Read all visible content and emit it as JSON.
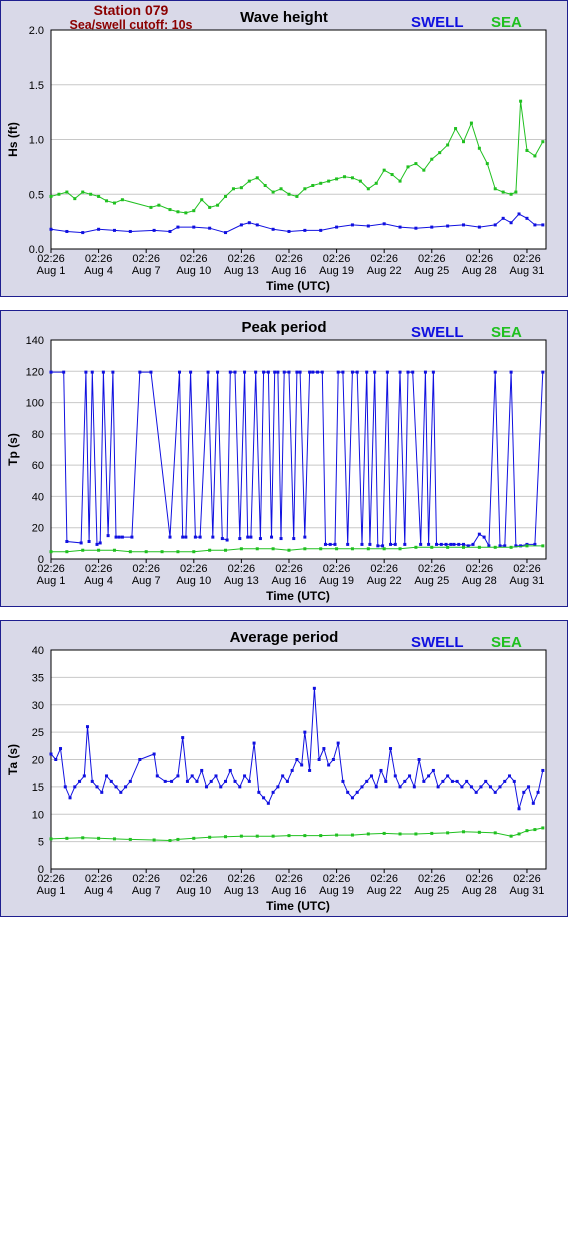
{
  "header": {
    "station": "Station 079",
    "cutoff": "Sea/swell cutoff: 10s"
  },
  "legend": {
    "swell": "SWELL",
    "sea": "SEA"
  },
  "colors": {
    "swell": "#1010e0",
    "sea": "#20c020",
    "frame": "#1f1f8f",
    "panel_bg": "#d9d9e8",
    "header": "#8b0000"
  },
  "chart_data": [
    {
      "type": "scatter",
      "title": "Wave height",
      "xlabel": "Time (UTC)",
      "ylabel": "Hs (ft)",
      "ylim": [
        0,
        2
      ],
      "yticks": [
        "0.0",
        "0.5",
        "1.0",
        "1.5",
        "2.0"
      ],
      "xlim": [
        0,
        31.2
      ],
      "xticks": [
        {
          "time": "02:26",
          "date": "Aug 1",
          "day": 0
        },
        {
          "time": "02:26",
          "date": "Aug 4",
          "day": 3
        },
        {
          "time": "02:26",
          "date": "Aug 7",
          "day": 6
        },
        {
          "time": "02:26",
          "date": "Aug 10",
          "day": 9
        },
        {
          "time": "02:26",
          "date": "Aug 13",
          "day": 12
        },
        {
          "time": "02:26",
          "date": "Aug 16",
          "day": 15
        },
        {
          "time": "02:26",
          "date": "Aug 19",
          "day": 18
        },
        {
          "time": "02:26",
          "date": "Aug 22",
          "day": 21
        },
        {
          "time": "02:26",
          "date": "Aug 25",
          "day": 24
        },
        {
          "time": "02:26",
          "date": "Aug 28",
          "day": 27
        },
        {
          "time": "02:26",
          "date": "Aug 31",
          "day": 30
        }
      ],
      "grid": true,
      "series": [
        {
          "name": "SWELL",
          "color": "#1010e0",
          "x": [
            0,
            1,
            2,
            3,
            4,
            5,
            6.5,
            7.5,
            8,
            9,
            10,
            11,
            12,
            12.5,
            13,
            14,
            15,
            16,
            17,
            18,
            19,
            20,
            21,
            22,
            23,
            24,
            25,
            26,
            27,
            28,
            28.5,
            29,
            29.5,
            30,
            30.5,
            31
          ],
          "y": [
            0.18,
            0.16,
            0.15,
            0.18,
            0.17,
            0.16,
            0.17,
            0.16,
            0.2,
            0.2,
            0.19,
            0.15,
            0.22,
            0.24,
            0.22,
            0.18,
            0.16,
            0.17,
            0.17,
            0.2,
            0.22,
            0.21,
            0.23,
            0.2,
            0.19,
            0.2,
            0.21,
            0.22,
            0.2,
            0.22,
            0.28,
            0.24,
            0.32,
            0.28,
            0.22,
            0.22
          ]
        },
        {
          "name": "SEA",
          "color": "#20c020",
          "x": [
            0,
            0.5,
            1,
            1.5,
            2,
            2.5,
            3,
            3.5,
            4,
            4.5,
            6.3,
            6.8,
            7.5,
            8,
            8.5,
            9,
            9.5,
            10,
            10.5,
            11,
            11.5,
            12,
            12.5,
            13,
            13.5,
            14,
            14.5,
            15,
            15.5,
            16,
            16.5,
            17,
            17.5,
            18,
            18.5,
            19,
            19.5,
            20,
            20.5,
            21,
            21.5,
            22,
            22.5,
            23,
            23.5,
            24,
            24.5,
            25,
            25.5,
            26,
            26.5,
            27,
            27.5,
            28,
            28.5,
            29,
            29.3,
            29.6,
            30,
            30.5,
            31
          ],
          "y": [
            0.48,
            0.5,
            0.52,
            0.46,
            0.52,
            0.5,
            0.48,
            0.44,
            0.42,
            0.45,
            0.38,
            0.4,
            0.36,
            0.34,
            0.33,
            0.35,
            0.45,
            0.38,
            0.4,
            0.48,
            0.55,
            0.56,
            0.62,
            0.65,
            0.58,
            0.52,
            0.55,
            0.5,
            0.48,
            0.55,
            0.58,
            0.6,
            0.62,
            0.64,
            0.66,
            0.65,
            0.62,
            0.55,
            0.6,
            0.72,
            0.68,
            0.62,
            0.75,
            0.78,
            0.72,
            0.82,
            0.88,
            0.95,
            1.1,
            0.98,
            1.15,
            0.92,
            0.78,
            0.55,
            0.52,
            0.5,
            0.52,
            1.35,
            0.9,
            0.85,
            0.98
          ]
        }
      ]
    },
    {
      "type": "line",
      "title": "Peak period",
      "xlabel": "Time (UTC)",
      "ylabel": "Tp (s)",
      "ylim": [
        0,
        150
      ],
      "yticks": [
        "0",
        "20",
        "40",
        "60",
        "80",
        "100",
        "120",
        "140"
      ],
      "xlim": [
        0,
        31.2
      ],
      "xticks": [
        {
          "time": "02:26",
          "date": "Aug 1",
          "day": 0
        },
        {
          "time": "02:26",
          "date": "Aug 4",
          "day": 3
        },
        {
          "time": "02:26",
          "date": "Aug 7",
          "day": 6
        },
        {
          "time": "02:26",
          "date": "Aug 10",
          "day": 9
        },
        {
          "time": "02:26",
          "date": "Aug 13",
          "day": 12
        },
        {
          "time": "02:26",
          "date": "Aug 16",
          "day": 15
        },
        {
          "time": "02:26",
          "date": "Aug 19",
          "day": 18
        },
        {
          "time": "02:26",
          "date": "Aug 22",
          "day": 21
        },
        {
          "time": "02:26",
          "date": "Aug 25",
          "day": 24
        },
        {
          "time": "02:26",
          "date": "Aug 28",
          "day": 27
        },
        {
          "time": "02:26",
          "date": "Aug 31",
          "day": 30
        }
      ],
      "grid": true,
      "series": [
        {
          "name": "SWELL",
          "color": "#1010e0",
          "x": [
            0,
            0.8,
            1,
            1.9,
            2.2,
            2.4,
            2.6,
            2.9,
            3.1,
            3.3,
            3.6,
            3.9,
            4.1,
            4.3,
            4.5,
            5.1,
            5.6,
            6.3,
            7.5,
            8.1,
            8.3,
            8.5,
            8.8,
            9.1,
            9.4,
            9.9,
            10.2,
            10.5,
            10.8,
            11.1,
            11.3,
            11.6,
            11.9,
            12.2,
            12.4,
            12.6,
            12.9,
            13.2,
            13.4,
            13.7,
            13.9,
            14.1,
            14.3,
            14.5,
            14.7,
            15.0,
            15.3,
            15.5,
            15.7,
            16.0,
            16.3,
            16.5,
            16.8,
            17.1,
            17.3,
            17.6,
            17.9,
            18.1,
            18.4,
            18.7,
            19.0,
            19.3,
            19.6,
            19.9,
            20.1,
            20.4,
            20.6,
            20.9,
            21.2,
            21.4,
            21.7,
            22.0,
            22.3,
            22.5,
            22.8,
            23.3,
            23.6,
            23.8,
            24.1,
            24.3,
            24.6,
            24.9,
            25.2,
            25.4,
            25.7,
            26.0,
            26.3,
            26.6,
            27.0,
            27.3,
            27.6,
            28.0,
            28.3,
            28.6,
            29.0,
            29.3,
            29.6,
            30.0,
            30.5,
            31.0
          ],
          "y": [
            128,
            128,
            12,
            11,
            128,
            12,
            128,
            10,
            11,
            128,
            16,
            128,
            15,
            15,
            15,
            15,
            128,
            128,
            15,
            128,
            15,
            15,
            128,
            15,
            15,
            128,
            15,
            128,
            14,
            13,
            128,
            128,
            14,
            128,
            15,
            15,
            128,
            14,
            128,
            128,
            15,
            128,
            128,
            14,
            128,
            128,
            14,
            128,
            128,
            15,
            128,
            128,
            128,
            128,
            10,
            10,
            10,
            128,
            128,
            10,
            128,
            128,
            10,
            128,
            10,
            128,
            9,
            9,
            128,
            10,
            10,
            128,
            10,
            128,
            128,
            10,
            128,
            10,
            128,
            10,
            10,
            10,
            10,
            10,
            10,
            10,
            9,
            10,
            17,
            15,
            9,
            128,
            9,
            9,
            128,
            9,
            9,
            10,
            10,
            128
          ]
        },
        {
          "name": "SEA",
          "color": "#20c020",
          "x": [
            0,
            1,
            2,
            3,
            4,
            5,
            6,
            7,
            8,
            9,
            10,
            11,
            12,
            13,
            14,
            15,
            16,
            17,
            18,
            19,
            20,
            21,
            22,
            23,
            24,
            25,
            26,
            27,
            28,
            29,
            30,
            31
          ],
          "y": [
            5,
            5,
            6,
            6,
            6,
            5,
            5,
            5,
            5,
            5,
            6,
            6,
            7,
            7,
            7,
            6,
            7,
            7,
            7,
            7,
            7,
            7,
            7,
            8,
            8,
            8,
            8,
            8,
            8,
            8,
            9,
            9
          ]
        }
      ]
    },
    {
      "type": "line",
      "title": "Average period",
      "xlabel": "Time (UTC)",
      "ylabel": "Ta (s)",
      "ylim": [
        0,
        40
      ],
      "yticks": [
        "0",
        "5",
        "10",
        "15",
        "20",
        "25",
        "30",
        "35",
        "40"
      ],
      "xlim": [
        0,
        31.2
      ],
      "xticks": [
        {
          "time": "02:26",
          "date": "Aug 1",
          "day": 0
        },
        {
          "time": "02:26",
          "date": "Aug 4",
          "day": 3
        },
        {
          "time": "02:26",
          "date": "Aug 7",
          "day": 6
        },
        {
          "time": "02:26",
          "date": "Aug 10",
          "day": 9
        },
        {
          "time": "02:26",
          "date": "Aug 13",
          "day": 12
        },
        {
          "time": "02:26",
          "date": "Aug 16",
          "day": 15
        },
        {
          "time": "02:26",
          "date": "Aug 19",
          "day": 18
        },
        {
          "time": "02:26",
          "date": "Aug 22",
          "day": 21
        },
        {
          "time": "02:26",
          "date": "Aug 25",
          "day": 24
        },
        {
          "time": "02:26",
          "date": "Aug 28",
          "day": 27
        },
        {
          "time": "02:26",
          "date": "Aug 31",
          "day": 30
        }
      ],
      "grid": true,
      "series": [
        {
          "name": "SWELL",
          "color": "#1010e0",
          "x": [
            0,
            0.3,
            0.6,
            0.9,
            1.2,
            1.5,
            1.8,
            2.1,
            2.3,
            2.6,
            2.9,
            3.2,
            3.5,
            3.8,
            4.1,
            4.4,
            4.7,
            5.0,
            5.6,
            6.5,
            6.7,
            7.2,
            7.6,
            8.0,
            8.3,
            8.6,
            8.9,
            9.2,
            9.5,
            9.8,
            10.1,
            10.4,
            10.7,
            11.0,
            11.3,
            11.6,
            11.9,
            12.2,
            12.5,
            12.8,
            13.1,
            13.4,
            13.7,
            14.0,
            14.3,
            14.6,
            14.9,
            15.2,
            15.5,
            15.8,
            16.0,
            16.3,
            16.6,
            16.9,
            17.2,
            17.5,
            17.8,
            18.1,
            18.4,
            18.7,
            19.0,
            19.3,
            19.6,
            19.9,
            20.2,
            20.5,
            20.8,
            21.1,
            21.4,
            21.7,
            22.0,
            22.3,
            22.6,
            22.9,
            23.2,
            23.5,
            23.8,
            24.1,
            24.4,
            24.7,
            25.0,
            25.3,
            25.6,
            25.9,
            26.2,
            26.5,
            26.8,
            27.1,
            27.4,
            27.7,
            28.0,
            28.3,
            28.6,
            28.9,
            29.2,
            29.5,
            29.8,
            30.1,
            30.4,
            30.7,
            31.0
          ],
          "y": [
            21,
            20,
            22,
            15,
            13,
            15,
            16,
            17,
            26,
            16,
            15,
            14,
            17,
            16,
            15,
            14,
            15,
            16,
            20,
            21,
            17,
            16,
            16,
            17,
            24,
            16,
            17,
            16,
            18,
            15,
            16,
            17,
            15,
            16,
            18,
            16,
            15,
            17,
            16,
            23,
            14,
            13,
            12,
            14,
            15,
            17,
            16,
            18,
            20,
            19,
            25,
            18,
            33,
            20,
            22,
            19,
            20,
            23,
            16,
            14,
            13,
            14,
            15,
            16,
            17,
            15,
            18,
            16,
            22,
            17,
            15,
            16,
            17,
            15,
            20,
            16,
            17,
            18,
            15,
            16,
            17,
            16,
            16,
            15,
            16,
            15,
            14,
            15,
            16,
            15,
            14,
            15,
            16,
            17,
            16,
            11,
            14,
            15,
            12,
            14,
            18
          ]
        },
        {
          "name": "SEA",
          "color": "#20c020",
          "x": [
            0,
            1,
            2,
            3,
            4,
            5,
            6.5,
            7.5,
            8,
            9,
            10,
            11,
            12,
            13,
            14,
            15,
            16,
            17,
            18,
            19,
            20,
            21,
            22,
            23,
            24,
            25,
            26,
            27,
            28,
            29,
            29.5,
            30,
            30.5,
            31
          ],
          "y": [
            5.5,
            5.6,
            5.7,
            5.6,
            5.5,
            5.4,
            5.3,
            5.2,
            5.4,
            5.6,
            5.8,
            5.9,
            6.0,
            6.0,
            6.0,
            6.1,
            6.1,
            6.1,
            6.2,
            6.2,
            6.4,
            6.5,
            6.4,
            6.4,
            6.5,
            6.6,
            6.8,
            6.7,
            6.6,
            6.0,
            6.4,
            7.0,
            7.2,
            7.5
          ]
        }
      ]
    }
  ]
}
